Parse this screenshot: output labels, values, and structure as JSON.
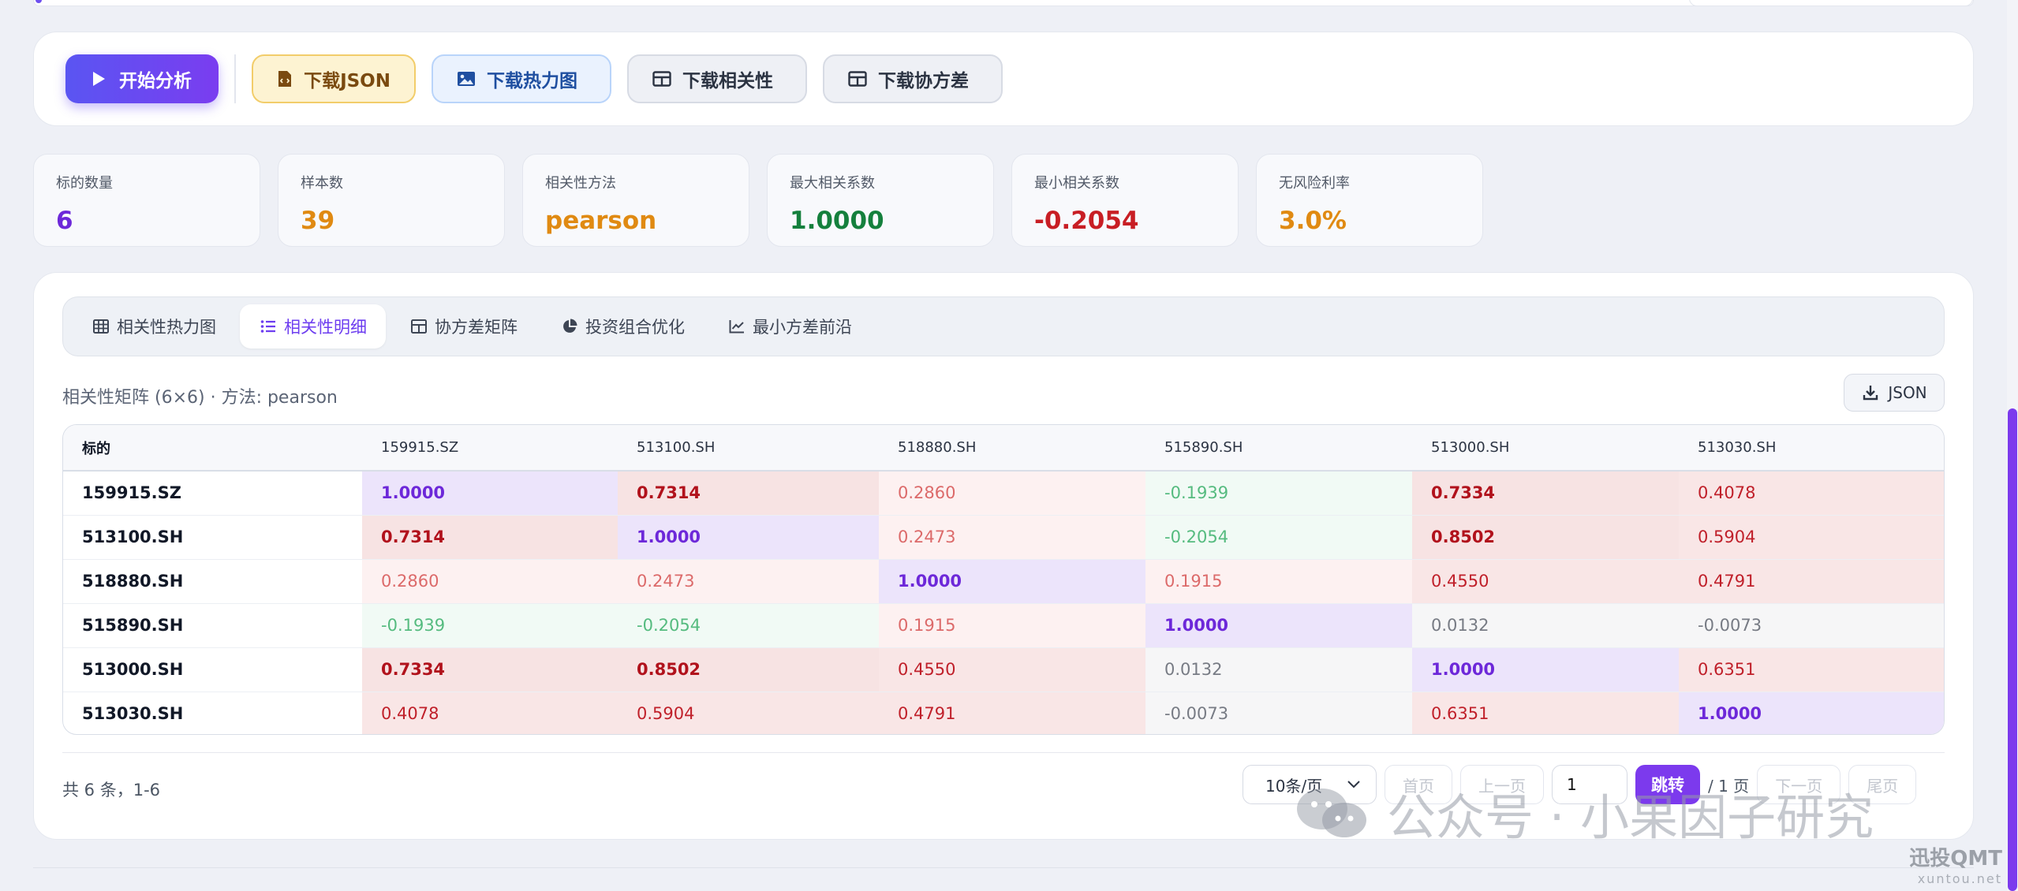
{
  "toolbar": {
    "start_label": "开始分析",
    "json_label": "下载JSON",
    "heatmap_label": "下载热力图",
    "corr_label": "下载相关性",
    "cov_label": "下载协方差"
  },
  "stats": [
    {
      "label": "标的数量",
      "value": "6",
      "color": "#6d28d9"
    },
    {
      "label": "样本数",
      "value": "39",
      "color": "#e08a12"
    },
    {
      "label": "相关性方法",
      "value": "pearson",
      "color": "#e08a12"
    },
    {
      "label": "最大相关系数",
      "value": "1.0000",
      "color": "#15803d"
    },
    {
      "label": "最小相关系数",
      "value": "-0.2054",
      "color": "#c81e24"
    },
    {
      "label": "无风险利率",
      "value": "3.0%",
      "color": "#e08a12"
    }
  ],
  "tabs": [
    {
      "label": "相关性热力图",
      "icon": "grid-icon"
    },
    {
      "label": "相关性明细",
      "icon": "list-icon"
    },
    {
      "label": "协方差矩阵",
      "icon": "table-icon"
    },
    {
      "label": "投资组合优化",
      "icon": "pie-icon"
    },
    {
      "label": "最小方差前沿",
      "icon": "line-chart-icon"
    }
  ],
  "section_title": "相关性矩阵 (6×6) · 方法: pearson",
  "json_button_label": "JSON",
  "table": {
    "headers": [
      "标的",
      "159915.SZ",
      "513100.SH",
      "518880.SH",
      "515890.SH",
      "513000.SH",
      "513030.SH"
    ],
    "rows": [
      [
        "159915.SZ",
        "1.0000",
        "0.7314",
        "0.2860",
        "-0.1939",
        "0.7334",
        "0.4078"
      ],
      [
        "513100.SH",
        "0.7314",
        "1.0000",
        "0.2473",
        "-0.2054",
        "0.8502",
        "0.5904"
      ],
      [
        "518880.SH",
        "0.2860",
        "0.2473",
        "1.0000",
        "0.1915",
        "0.4550",
        "0.4791"
      ],
      [
        "515890.SH",
        "-0.1939",
        "-0.2054",
        "0.1915",
        "1.0000",
        "0.0132",
        "-0.0073"
      ],
      [
        "513000.SH",
        "0.7334",
        "0.8502",
        "0.4550",
        "0.0132",
        "1.0000",
        "0.6351"
      ],
      [
        "513030.SH",
        "0.4078",
        "0.5904",
        "0.4791",
        "-0.0073",
        "0.6351",
        "1.0000"
      ]
    ]
  },
  "pagination": {
    "total_text": "共 6 条，1-6",
    "page_size": "10条/页",
    "first": "首页",
    "prev": "上一页",
    "current": "1",
    "jump": "跳转",
    "page_of": "/ 1 页",
    "next": "下一页",
    "last": "尾页"
  },
  "watermark": {
    "text": "公众号 · 小果因子研究",
    "brand": "迅投QMT",
    "site": "xuntou.net"
  }
}
